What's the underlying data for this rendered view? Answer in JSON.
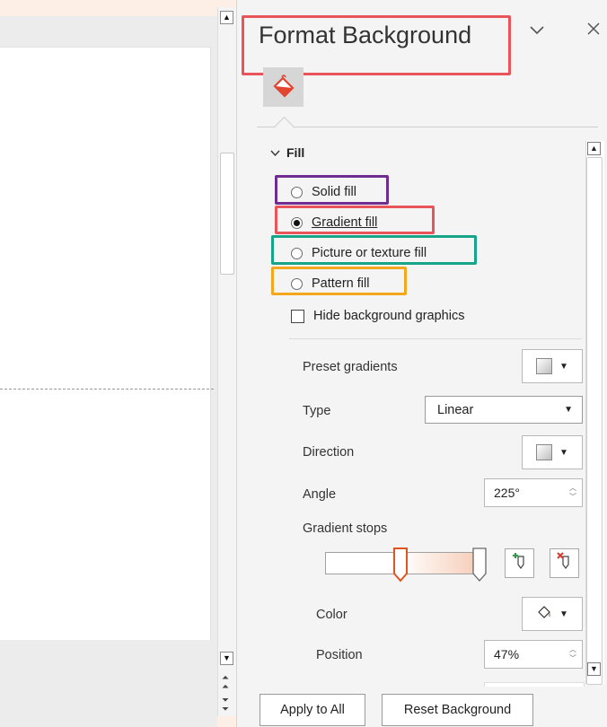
{
  "pane": {
    "title": "Format Background",
    "menu_icon": "chevron-down-icon",
    "close_icon": "close-icon",
    "tab_icon": "paint-bucket-icon"
  },
  "fill": {
    "section_label": "Fill",
    "options": [
      {
        "label": "Solid fill",
        "selected": false
      },
      {
        "label": "Gradient fill",
        "selected": true
      },
      {
        "label": "Picture or texture fill",
        "selected": false
      },
      {
        "label": "Pattern fill",
        "selected": false
      }
    ],
    "hide_bg_label": "Hide background graphics",
    "hide_bg_checked": false
  },
  "gradient": {
    "preset_label": "Preset gradients",
    "type_label": "Type",
    "type_value": "Linear",
    "direction_label": "Direction",
    "angle_label": "Angle",
    "angle_value": "225°",
    "stops_label": "Gradient stops",
    "stop_positions": [
      0.47,
      1.0
    ],
    "color_label": "Color",
    "position_label": "Position",
    "position_value": "47%",
    "end_color": "#f6c9b2"
  },
  "footer": {
    "apply_all_label": "Apply to All",
    "reset_label": "Reset Background"
  },
  "highlight_colors": {
    "red": "#e9535a",
    "purple": "#6f2c91",
    "teal": "#17a58a",
    "orange": "#f3a71c"
  }
}
